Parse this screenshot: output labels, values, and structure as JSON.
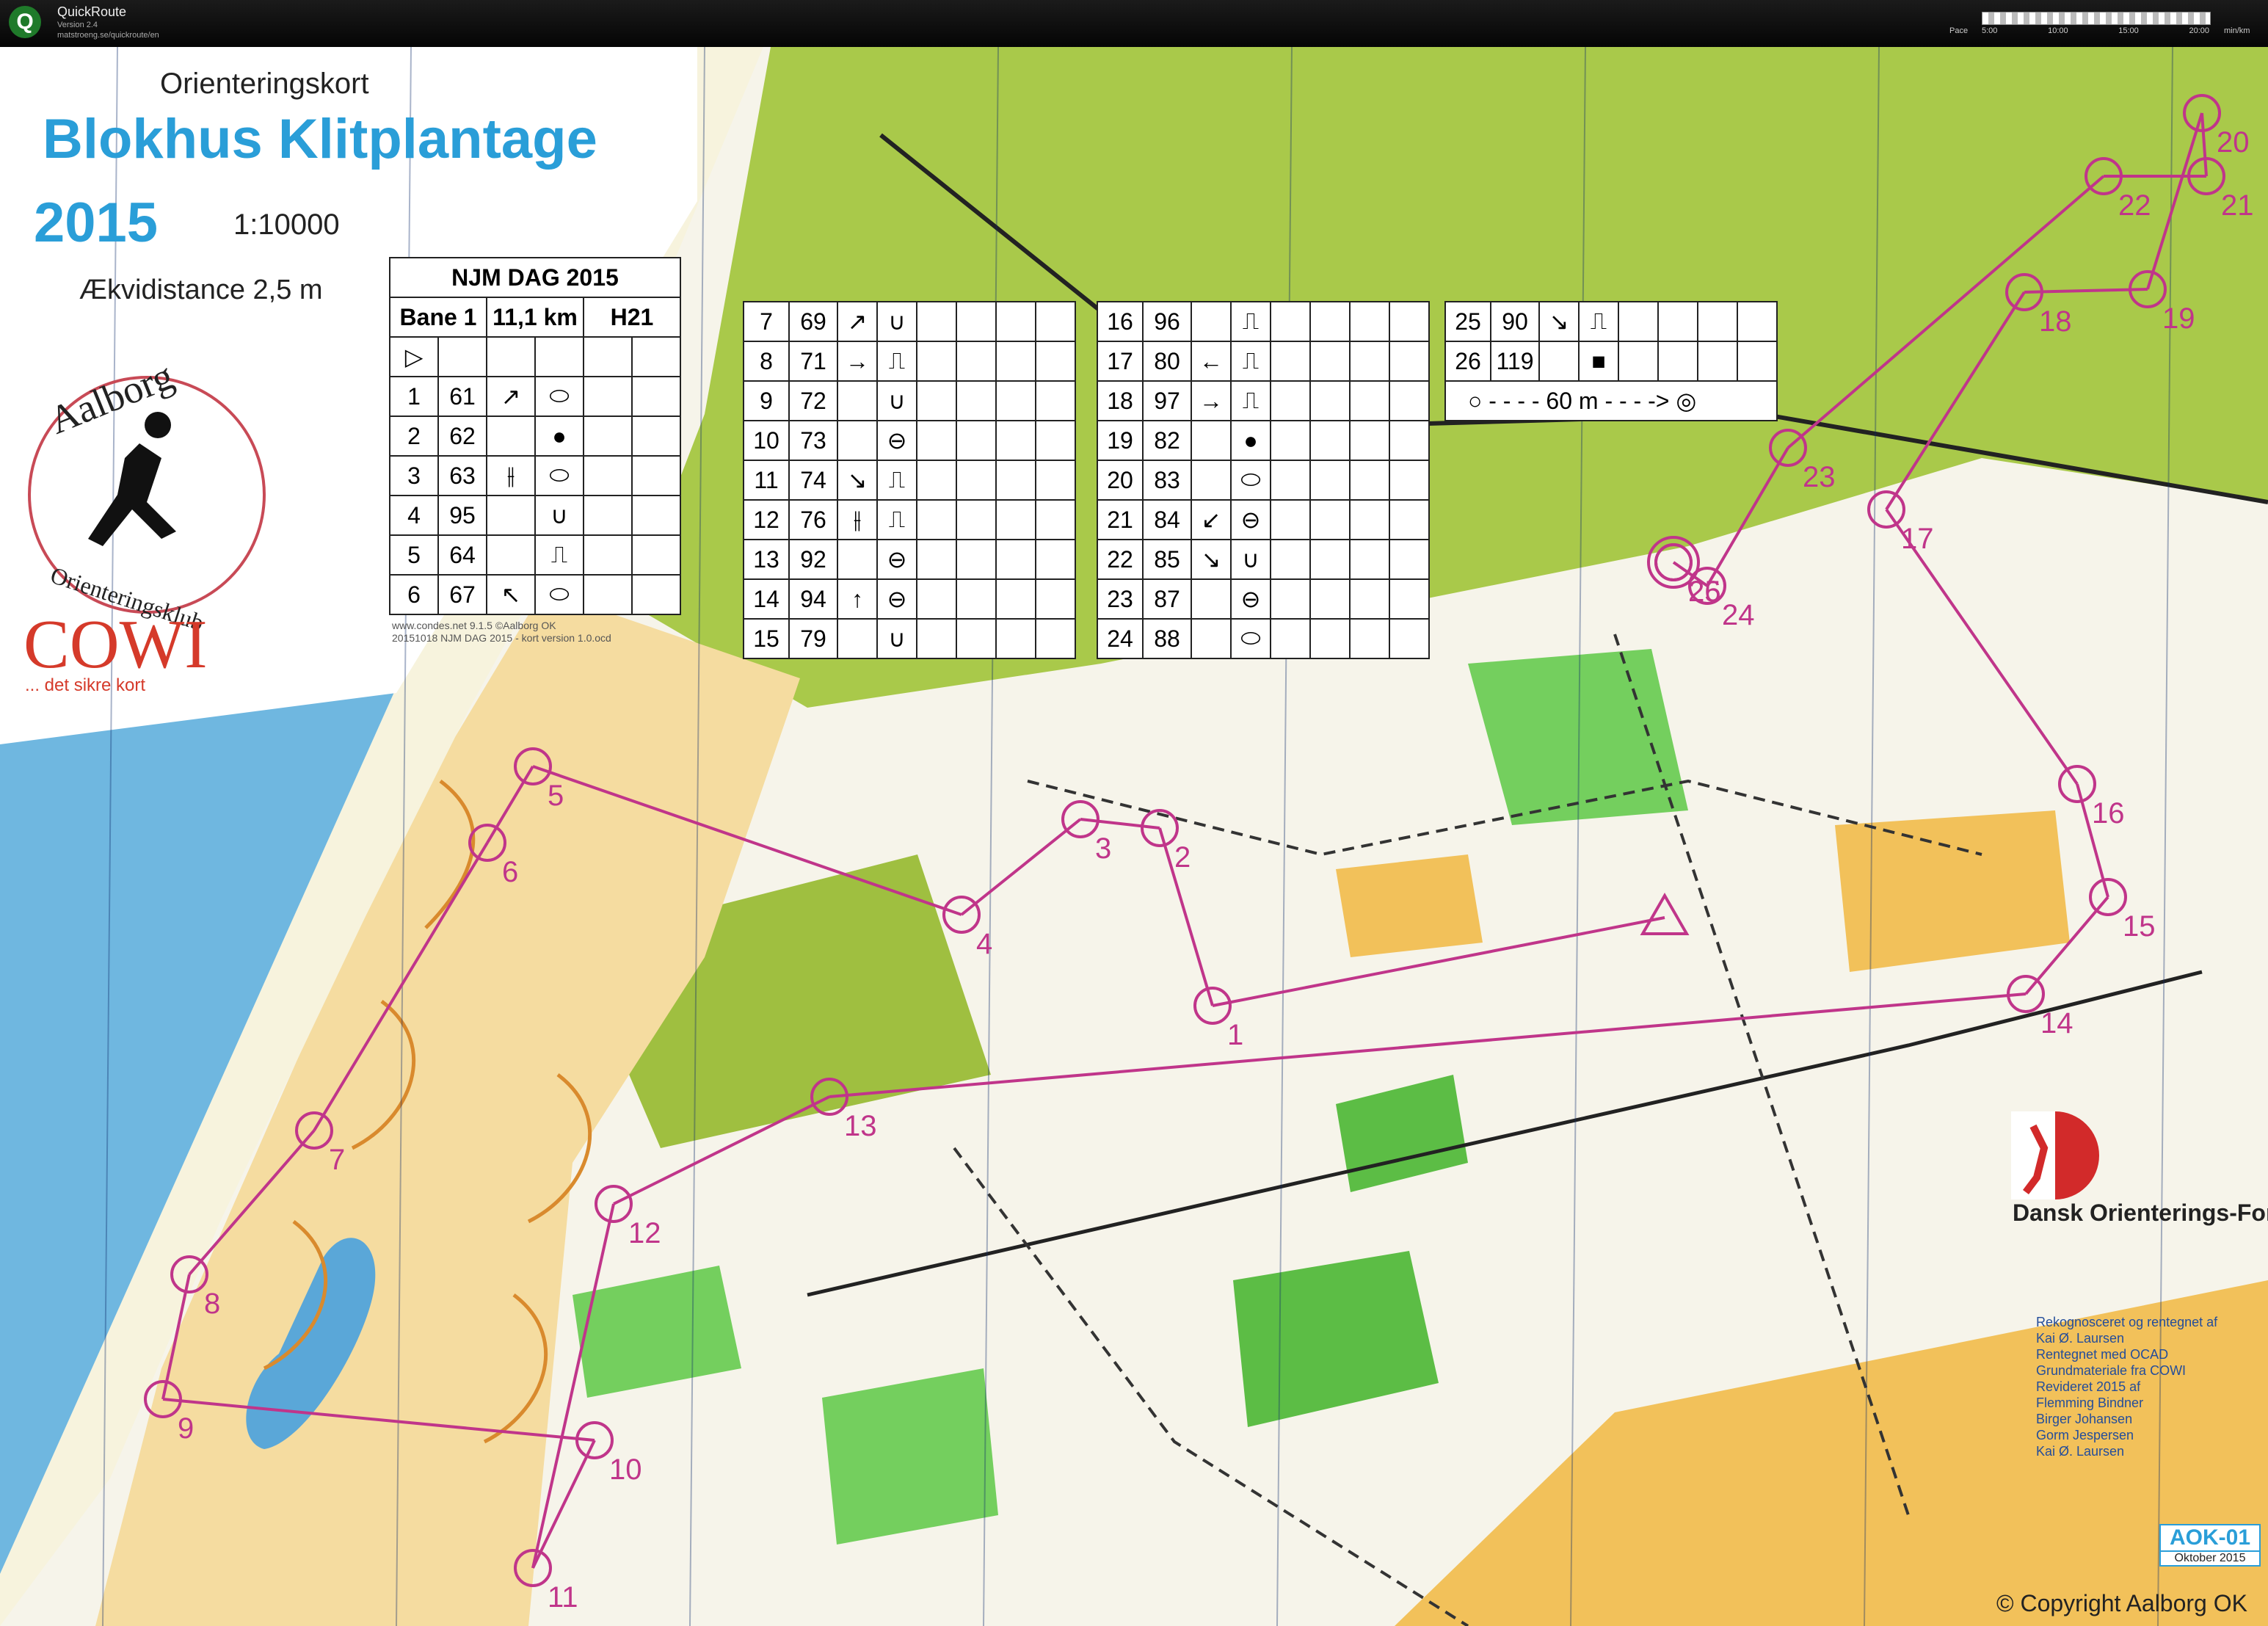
{
  "app": {
    "name": "QuickRoute",
    "version": "Version 2.4",
    "url": "matstroeng.se/quickroute/en",
    "pace_label": "Pace",
    "pace_ticks": [
      "5:00",
      "10:00",
      "15:00",
      "20:00"
    ],
    "pace_unit": "min/km"
  },
  "map": {
    "subtitle": "Orienteringskort",
    "title": "Blokhus Klitplantage",
    "year": "2015",
    "scale": "1:10000",
    "contour_interval": "Ækvidistance 2,5 m",
    "club_name": "Aalborg",
    "club_subtitle": "Orienteringsklub",
    "sponsor_name": "COWI",
    "sponsor_tagline": "... det sikre kort",
    "software_note": [
      "www.condes.net 9.1.5 ©Aalborg OK",
      "20151018 NJM DAG 2015 - kort version 1.0.ocd"
    ],
    "federation": "Dansk Orienterings-Forbund",
    "credits": [
      "Rekognosceret og rentegnet af",
      "Kai Ø. Laursen",
      "Rentegnet med OCAD",
      "Grundmateriale fra COWI",
      "Revideret 2015 af",
      "Flemming Bindner",
      "Birger Johansen",
      "Gorm Jespersen",
      "Kai Ø. Laursen"
    ],
    "map_code": "AOK-01",
    "map_date": "Oktober 2015",
    "copyright": "© Copyright Aalborg OK"
  },
  "course": {
    "event": "NJM DAG 2015",
    "course_name": "Bane 1",
    "length": "11,1 km",
    "class": "H21",
    "finish_distance": "60 m",
    "controls": [
      {
        "num": "1",
        "code": "61",
        "dir": "↗",
        "feature": "⬭"
      },
      {
        "num": "2",
        "code": "62",
        "dir": "",
        "feature": "●"
      },
      {
        "num": "3",
        "code": "63",
        "dir": "⫲",
        "feature": "⬭"
      },
      {
        "num": "4",
        "code": "95",
        "dir": "",
        "feature": "∪"
      },
      {
        "num": "5",
        "code": "64",
        "dir": "",
        "feature": "⎍"
      },
      {
        "num": "6",
        "code": "67",
        "dir": "↖",
        "feature": "⬭"
      },
      {
        "num": "7",
        "code": "69",
        "dir": "↗",
        "feature": "∪"
      },
      {
        "num": "8",
        "code": "71",
        "dir": "→",
        "feature": "⎍"
      },
      {
        "num": "9",
        "code": "72",
        "dir": "",
        "feature": "∪"
      },
      {
        "num": "10",
        "code": "73",
        "dir": "",
        "feature": "⊖"
      },
      {
        "num": "11",
        "code": "74",
        "dir": "↘",
        "feature": "⎍"
      },
      {
        "num": "12",
        "code": "76",
        "dir": "⫲",
        "feature": "⎍"
      },
      {
        "num": "13",
        "code": "92",
        "dir": "",
        "feature": "⊖"
      },
      {
        "num": "14",
        "code": "94",
        "dir": "↑",
        "feature": "⊖"
      },
      {
        "num": "15",
        "code": "79",
        "dir": "",
        "feature": "∪"
      },
      {
        "num": "16",
        "code": "96",
        "dir": "",
        "feature": "⎍"
      },
      {
        "num": "17",
        "code": "80",
        "dir": "←",
        "feature": "⎍"
      },
      {
        "num": "18",
        "code": "97",
        "dir": "→",
        "feature": "⎍"
      },
      {
        "num": "19",
        "code": "82",
        "dir": "",
        "feature": "●"
      },
      {
        "num": "20",
        "code": "83",
        "dir": "",
        "feature": "⬭"
      },
      {
        "num": "21",
        "code": "84",
        "dir": "↙",
        "feature": "⊖"
      },
      {
        "num": "22",
        "code": "85",
        "dir": "↘",
        "feature": "∪"
      },
      {
        "num": "23",
        "code": "87",
        "dir": "",
        "feature": "⊖"
      },
      {
        "num": "24",
        "code": "88",
        "dir": "",
        "feature": "⬭"
      },
      {
        "num": "25",
        "code": "90",
        "dir": "↘",
        "feature": "⎍"
      },
      {
        "num": "26",
        "code": "119",
        "dir": "",
        "feature": "■"
      }
    ]
  },
  "colors": {
    "forest_green": "#a9c94a",
    "open_yellow": "#f2c15a",
    "light_green": "#74cf5e",
    "water_blue": "#6fb7e0",
    "course_magenta": "#c0358a",
    "contour_brown": "#d98a2d"
  }
}
